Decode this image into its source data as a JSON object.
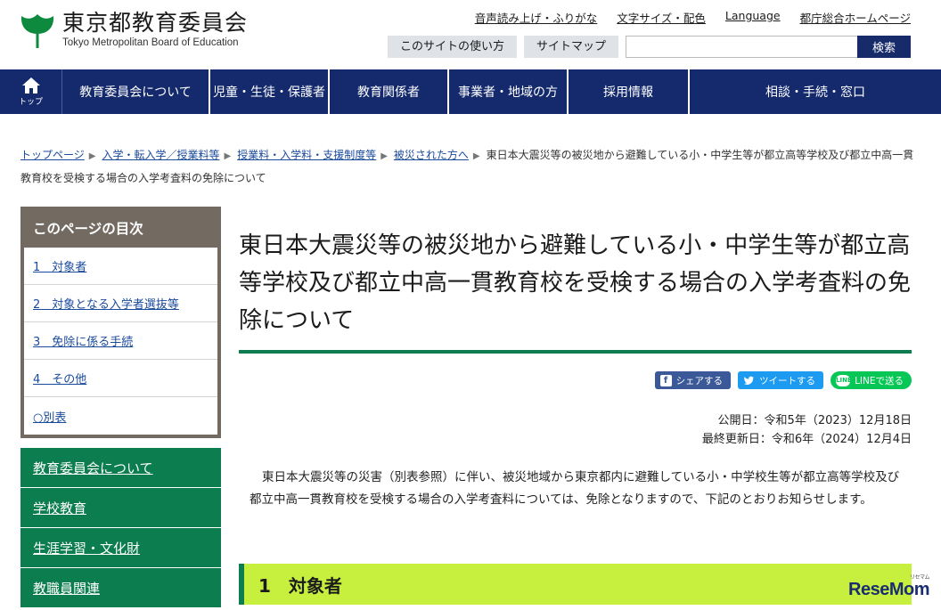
{
  "site": {
    "name_ja": "東京都教育委員会",
    "name_en": "Tokyo Metropolitan Board of Education"
  },
  "utility_links": [
    "音声読み上げ・ふりがな",
    "文字サイズ・配色",
    "Language",
    "都庁総合ホームページ"
  ],
  "tools": {
    "howto": "このサイトの使い方",
    "sitemap": "サイトマップ",
    "search_placeholder": "",
    "search_button": "検索"
  },
  "nav": {
    "home_label": "トップ",
    "items": [
      "教育委員会について",
      "児童・生徒・保護者",
      "教育関係者",
      "事業者・地域の方",
      "採用情報",
      "相談・手続・窓口"
    ]
  },
  "breadcrumb": {
    "links": [
      "トップページ",
      "入学・転入学／授業料等",
      "授業料・入学料・支援制度等",
      "被災された方へ"
    ],
    "current": "東日本大震災等の被災地から避難している小・中学生等が都立高等学校及び都立中高一貫教育校を受検する場合の入学考査料の免除について"
  },
  "toc": {
    "heading": "このページの目次",
    "items": [
      "1　対象者",
      "2　対象となる入学者選抜等",
      "3　免除に係る手続",
      "4　その他",
      "○別表"
    ]
  },
  "side_menu": [
    "教育委員会について",
    "学校教育",
    "生涯学習・文化財",
    "教職員関連"
  ],
  "page": {
    "title": "東日本大震災等の被災地から避難している小・中学生等が都立高等学校及び都立中高一貫教育校を受検する場合の入学考査料の免除について",
    "share": {
      "facebook": "シェアする",
      "twitter": "ツイートする",
      "line": "LINEで送る",
      "line_icon_text": "LINE",
      "facebook_icon_text": "f"
    },
    "published": "公開日：令和5年（2023）12月18日",
    "updated": "最終更新日：令和6年（2024）12月4日",
    "lead": "東日本大震災等の災害（別表参照）に伴い、被災地域から東京都内に避難している小・中学校生等が都立高等学校及び都立中高一貫教育校を受検する場合の入学考査料については、免除となりますので、下記のとおりお知らせします。",
    "section1": "1　対象者"
  },
  "watermark": {
    "text": "ReseMom",
    "sub": "リセマム"
  },
  "colors": {
    "nav_bg": "#142a6d",
    "accent_green": "#0b7d4e",
    "section_bg": "#c6ef3e",
    "toc_border": "#736b62"
  }
}
